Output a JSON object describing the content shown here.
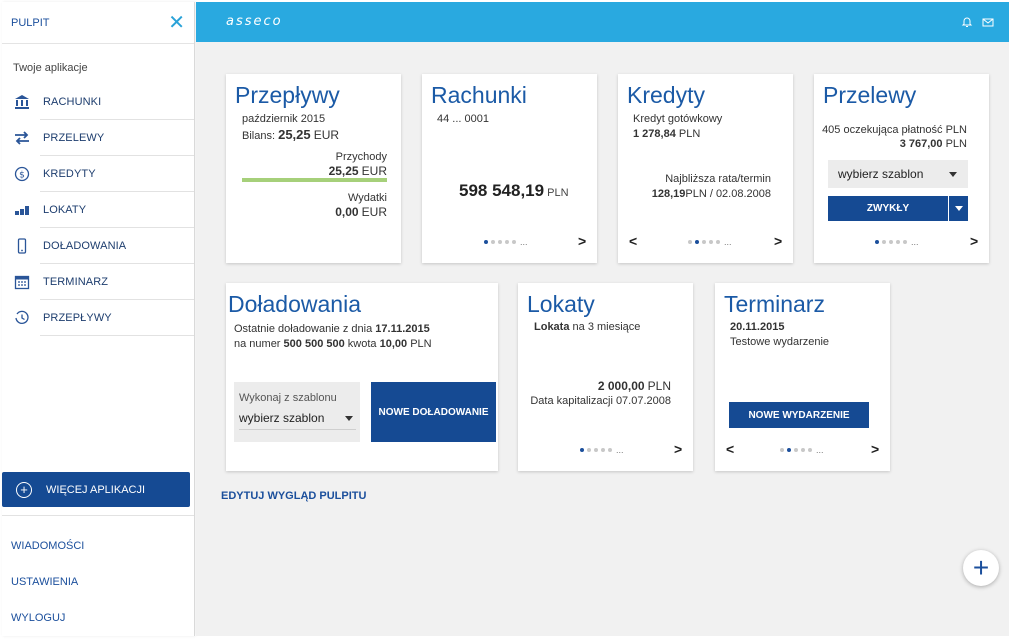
{
  "sidebar": {
    "title": "PULPIT",
    "close_icon": "close-icon",
    "subtitle": "Twoje aplikacje",
    "items": [
      {
        "label": "RACHUNKI",
        "icon": "bank-icon"
      },
      {
        "label": "PRZELEWY",
        "icon": "transfer-arrows-icon"
      },
      {
        "label": "KREDYTY",
        "icon": "dollar-coin-icon"
      },
      {
        "label": "LOKATY",
        "icon": "coin-stack-icon"
      },
      {
        "label": "DOŁADOWANIA",
        "icon": "mobile-phone-icon"
      },
      {
        "label": "TERMINARZ",
        "icon": "calendar-icon"
      },
      {
        "label": "PRZEPŁYWY",
        "icon": "history-clock-icon"
      }
    ],
    "more_apps": "WIĘCEJ APLIKACJI",
    "bottom_links": [
      "WIADOMOŚCI",
      "USTAWIENIA",
      "WYLOGUJ"
    ]
  },
  "topbar": {
    "logo": "asseco",
    "icons": [
      "bell-icon",
      "envelope-icon"
    ]
  },
  "colors": {
    "accent": "#29a9e0",
    "primary": "#154a93",
    "title": "#1b5aa6",
    "income_bar": "#a6d07a"
  },
  "cards": {
    "przeplywy": {
      "title": "Przepływy",
      "period": "październik 2015",
      "balance_label": "Bilans:",
      "balance_value": "25,25",
      "balance_currency": "EUR",
      "income_label": "Przychody",
      "income_value": "25,25",
      "income_currency": "EUR",
      "income_fraction": 1.0,
      "expense_label": "Wydatki",
      "expense_value": "0,00",
      "expense_currency": "EUR"
    },
    "rachunki": {
      "title": "Rachunki",
      "account": "44 ... 0001",
      "amount": "598 548,19",
      "currency": "PLN",
      "page": 1,
      "pages": 5
    },
    "kredyty": {
      "title": "Kredyty",
      "name": "Kredyt gotówkowy",
      "amount": "1 278,84",
      "currency": "PLN",
      "next_label": "Najbliższa rata/termin",
      "next_amount": "128,19",
      "next_rest": "PLN / 02.08.2008",
      "page": 2,
      "pages": 5
    },
    "przelewy": {
      "title": "Przelewy",
      "pending": "405 oczekująca płatność PLN",
      "amount": "3 767,00",
      "currency": "PLN",
      "template_select": "wybierz szablon",
      "button": "ZWYKŁY",
      "page": 1,
      "pages": 5
    },
    "doladowania": {
      "title": "Doładowania",
      "line1_prefix": "Ostatnie doładowanie z dnia",
      "line1_date": "17.11.2015",
      "line2_prefix": "na numer",
      "line2_number": "500 500 500",
      "line2_mid": "kwota",
      "line2_amount": "10,00",
      "line2_currency": "PLN",
      "template_label": "Wykonaj z szablonu",
      "template_select": "wybierz szablon",
      "button": "NOWE DOŁADOWANIE"
    },
    "lokaty": {
      "title": "Lokaty",
      "name_bold": "Lokata",
      "name_rest": "na 3 miesiące",
      "amount": "2 000,00",
      "currency": "PLN",
      "cap_label": "Data kapitalizacji 07.07.2008",
      "page": 1,
      "pages": 5
    },
    "terminarz": {
      "title": "Terminarz",
      "date": "20.11.2015",
      "event": "Testowe wydarzenie",
      "button": "NOWE WYDARZENIE",
      "page": 2,
      "pages": 5
    }
  },
  "edit_link": "EDYTUJ WYGLĄD PULPITU",
  "fab_icon": "plus-icon",
  "glyphs": {
    "prev": "<",
    "next": ">",
    "ellipsis": "...",
    "plus": "+",
    "close": "✕"
  }
}
